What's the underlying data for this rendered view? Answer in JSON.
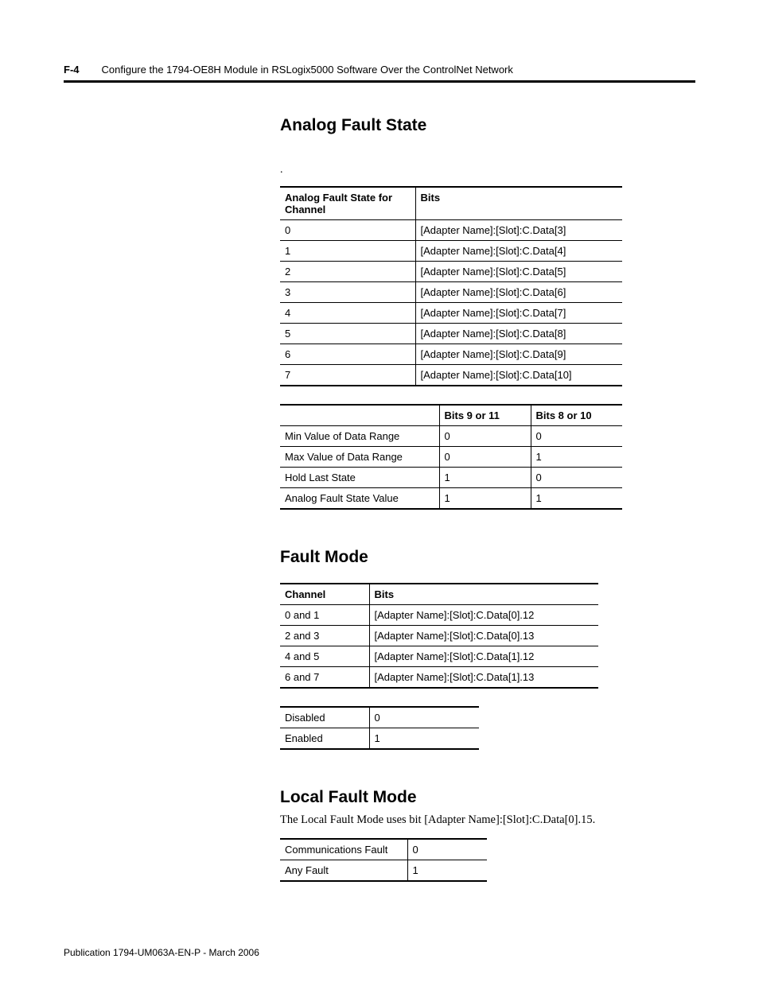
{
  "header": {
    "page_number": "F-4",
    "title": "Configure the 1794-OE8H Module in RSLogix5000 Software Over the ControlNet Network"
  },
  "section_afs": {
    "heading": "Analog Fault State",
    "dot": ".",
    "table1": {
      "col1": "Analog Fault State for Channel",
      "col2": "Bits",
      "rows": [
        {
          "ch": "0",
          "bits": "[Adapter Name]:[Slot]:C.Data[3]"
        },
        {
          "ch": "1",
          "bits": "[Adapter Name]:[Slot]:C.Data[4]"
        },
        {
          "ch": "2",
          "bits": "[Adapter Name]:[Slot]:C.Data[5]"
        },
        {
          "ch": "3",
          "bits": "[Adapter Name]:[Slot]:C.Data[6]"
        },
        {
          "ch": "4",
          "bits": "[Adapter Name]:[Slot]:C.Data[7]"
        },
        {
          "ch": "5",
          "bits": "[Adapter Name]:[Slot]:C.Data[8]"
        },
        {
          "ch": "6",
          "bits": "[Adapter Name]:[Slot]:C.Data[9]"
        },
        {
          "ch": "7",
          "bits": "[Adapter Name]:[Slot]:C.Data[10]"
        }
      ]
    },
    "table2": {
      "col1": "",
      "col2": "Bits 9 or 11",
      "col3": "Bits 8 or 10",
      "rows": [
        {
          "label": "Min Value of Data Range",
          "b9": "0",
          "b8": "0"
        },
        {
          "label": "Max Value of Data Range",
          "b9": "0",
          "b8": "1"
        },
        {
          "label": "Hold Last State",
          "b9": "1",
          "b8": "0"
        },
        {
          "label": "Analog Fault State Value",
          "b9": "1",
          "b8": "1"
        }
      ]
    }
  },
  "section_fm": {
    "heading": "Fault Mode",
    "table1": {
      "col1": "Channel",
      "col2": "Bits",
      "rows": [
        {
          "ch": "0 and 1",
          "bits": "[Adapter Name]:[Slot]:C.Data[0].12"
        },
        {
          "ch": "2 and 3",
          "bits": "[Adapter Name]:[Slot]:C.Data[0].13"
        },
        {
          "ch": "4 and 5",
          "bits": "[Adapter Name]:[Slot]:C.Data[1].12"
        },
        {
          "ch": "6 and 7",
          "bits": "[Adapter Name]:[Slot]:C.Data[1].13"
        }
      ]
    },
    "table2": {
      "rows": [
        {
          "label": "Disabled",
          "val": "0"
        },
        {
          "label": "Enabled",
          "val": "1"
        }
      ]
    }
  },
  "section_lfm": {
    "heading": "Local Fault Mode",
    "body": "The Local Fault Mode uses bit [Adapter Name]:[Slot]:C.Data[0].15.",
    "table": {
      "rows": [
        {
          "label": "Communications Fault",
          "val": "0"
        },
        {
          "label": "Any Fault",
          "val": "1"
        }
      ]
    }
  },
  "footer": "Publication 1794-UM063A-EN-P - March 2006"
}
